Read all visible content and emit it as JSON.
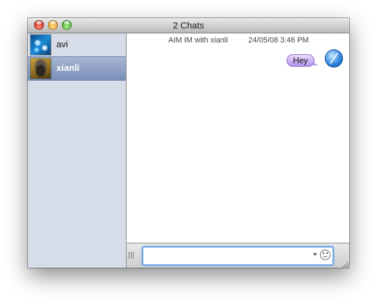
{
  "window": {
    "title": "2 Chats"
  },
  "sidebar": {
    "contacts": [
      {
        "name": "avi",
        "selected": false
      },
      {
        "name": "xianli",
        "selected": true
      }
    ]
  },
  "chat": {
    "service_label": "AIM IM with xianli",
    "timestamp": "24/05/08 3:46 PM",
    "messages": [
      {
        "text": "Hey",
        "bubble_color": "#c9adf3"
      }
    ]
  },
  "input": {
    "value": "",
    "placeholder": ""
  },
  "icons": {
    "close": "close-icon",
    "minimize": "minimize-icon",
    "zoom": "zoom-icon",
    "smiley": "smiley-icon",
    "buddy": "buddy-icon"
  },
  "colors": {
    "selection": "#7b8fb7",
    "sidebar": "#d6dde9",
    "input_focus": "#6fa6e8"
  }
}
